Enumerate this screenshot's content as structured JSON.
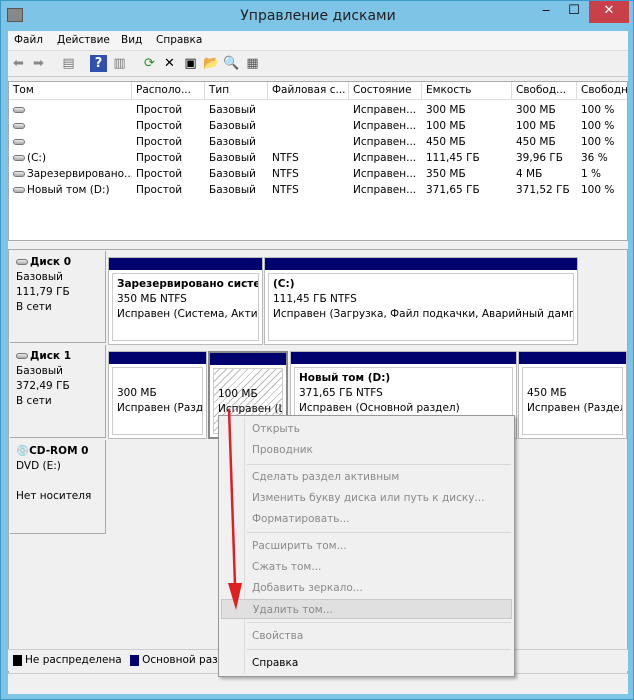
{
  "window": {
    "title": "Управление дисками",
    "minimize": "‒",
    "maximize": "☐",
    "close": "✕"
  },
  "menu": [
    "Файл",
    "Действие",
    "Вид",
    "Справка"
  ],
  "toolbar": [
    "back-icon",
    "forward-icon",
    "console-tree-icon",
    "help-icon",
    "action-pane-icon",
    "refresh-icon",
    "delete-icon",
    "properties-icon",
    "open-icon",
    "explore-icon",
    "settings-icon"
  ],
  "table": {
    "headers": [
      "Том",
      "Располо...",
      "Тип",
      "Файловая с...",
      "Состояние",
      "Емкость",
      "Свобод...",
      "Свободно"
    ],
    "rows": [
      [
        "",
        "Простой",
        "Базовый",
        "",
        "Исправен...",
        "300 МБ",
        "300 МБ",
        "100 %"
      ],
      [
        "",
        "Простой",
        "Базовый",
        "",
        "Исправен...",
        "100 МБ",
        "100 МБ",
        "100 %"
      ],
      [
        "",
        "Простой",
        "Базовый",
        "",
        "Исправен...",
        "450 МБ",
        "450 МБ",
        "100 %"
      ],
      [
        "(C:)",
        "Простой",
        "Базовый",
        "NTFS",
        "Исправен...",
        "111,45 ГБ",
        "39,96 ГБ",
        "36 %"
      ],
      [
        "Зарезервировано...",
        "Простой",
        "Базовый",
        "NTFS",
        "Исправен...",
        "350 МБ",
        "4 МБ",
        "1 %"
      ],
      [
        "Новый том (D:)",
        "Простой",
        "Базовый",
        "NTFS",
        "Исправен...",
        "371,65 ГБ",
        "371,52 ГБ",
        "100 %"
      ]
    ]
  },
  "disks": [
    {
      "name": "Диск 0",
      "type": "Базовый",
      "size": "111,79 ГБ",
      "status": "В сети",
      "partitions": [
        {
          "title": "Зарезервировано системой",
          "size": "350 МБ NTFS",
          "status": "Исправен (Система, Активен, Основной раздел)"
        },
        {
          "title": "(C:)",
          "size": "111,45 ГБ NTFS",
          "status": "Исправен (Загрузка, Файл подкачки, Аварийный дамп памяти, Основной раздел)"
        }
      ]
    },
    {
      "name": "Диск 1",
      "type": "Базовый",
      "size": "372,49 ГБ",
      "status": "В сети",
      "partitions": [
        {
          "title": "",
          "size": "300 МБ",
          "status": "Исправен (Раздел восстановления)"
        },
        {
          "title": "",
          "size": "100 МБ",
          "status": "Исправен (Шифрованный (EFI) системный раздел)"
        },
        {
          "title": "Новый том  (D:)",
          "size": "371,65 ГБ NTFS",
          "status": "Исправен (Основной раздел)"
        },
        {
          "title": "",
          "size": "450 МБ",
          "status": "Исправен (Раздел восстановления)"
        }
      ]
    },
    {
      "name": "CD-ROM 0",
      "type": "DVD (E:)",
      "status": "Нет носителя"
    }
  ],
  "legend": [
    {
      "label": "Не распределена",
      "color": "#000000"
    },
    {
      "label": "Основной раздел",
      "color": "#00006e"
    }
  ],
  "context_menu": {
    "items": [
      "Открыть",
      "Проводник",
      "Сделать раздел активным",
      "Изменить букву диска или путь к диску...",
      "Форматировать...",
      "Расширить том...",
      "Сжать том...",
      "Добавить зеркало...",
      "Удалить том...",
      "Свойства",
      "Справка"
    ]
  },
  "annotation": {
    "arrow_color": "#e02020"
  }
}
